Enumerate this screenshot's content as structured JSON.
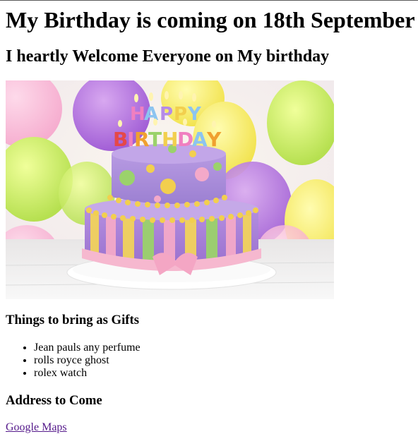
{
  "heading": {
    "title": "My Birthday is coming on 18th September",
    "welcome": "I heartly Welcome Everyone on My birthday"
  },
  "image": {
    "alt": "birthday cake",
    "cake_text_top": "HAPPY",
    "cake_text_bottom": "BIRTHDAY"
  },
  "gifts": {
    "heading": "Things to bring as Gifts",
    "items": [
      "Jean pauls any perfume",
      "rolls royce ghost",
      "rolex watch"
    ]
  },
  "address": {
    "heading": "Address to Come",
    "link_label": "Google Maps"
  },
  "colors": {
    "link_visited": "#551a8b"
  }
}
